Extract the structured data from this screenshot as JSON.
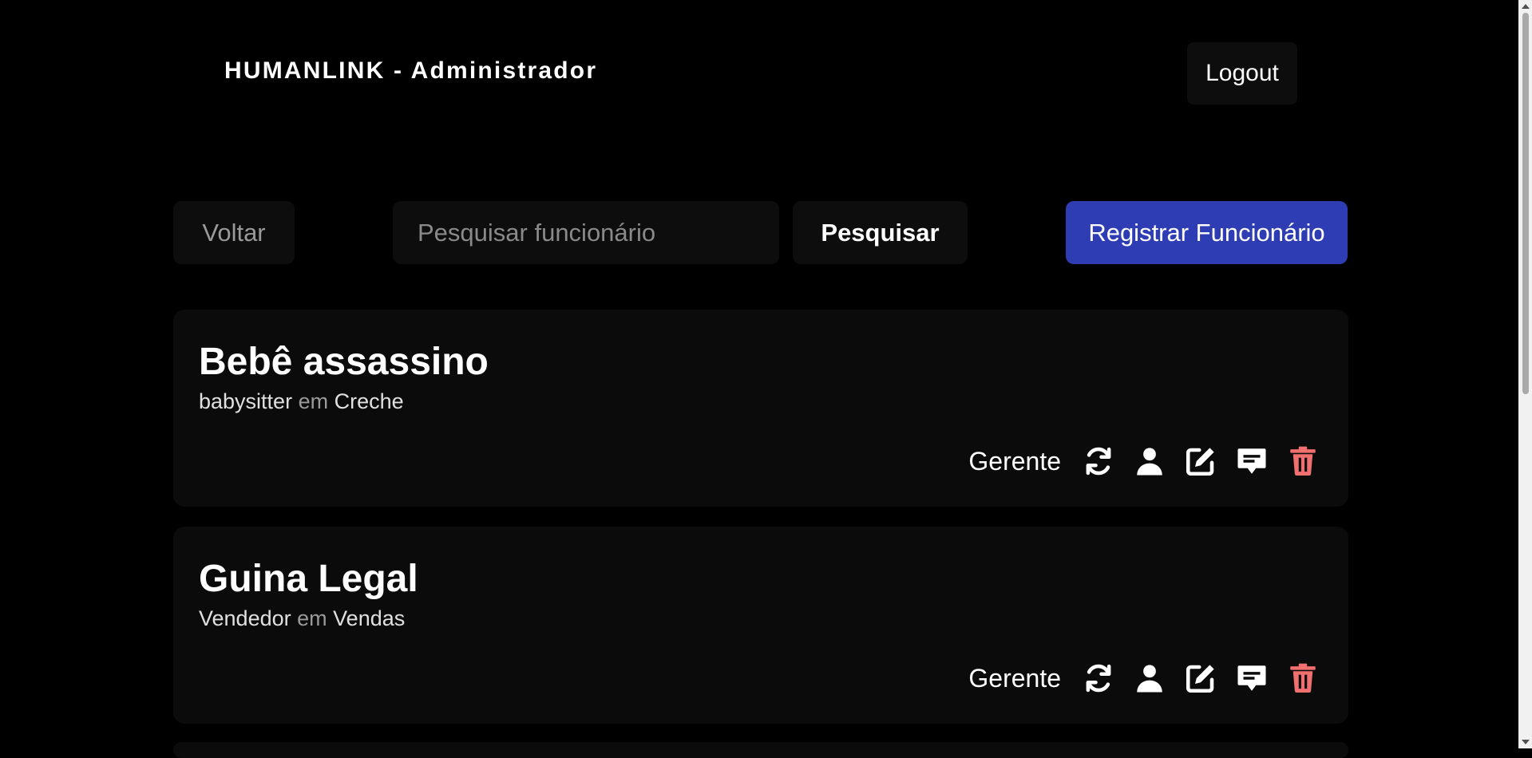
{
  "header": {
    "title": "HUMANLINK - Administrador",
    "logout_label": "Logout"
  },
  "toolbar": {
    "back_label": "Voltar",
    "search_placeholder": "Pesquisar funcionário",
    "search_button_label": "Pesquisar",
    "register_button_label": "Registrar Funcionário"
  },
  "employees": [
    {
      "name": "Bebê assassino",
      "role": "babysitter",
      "connector": "em",
      "department": "Creche",
      "level": "Gerente"
    },
    {
      "name": "Guina Legal",
      "role": "Vendedor",
      "connector": "em",
      "department": "Vendas",
      "level": "Gerente"
    }
  ],
  "icons": [
    "refresh-icon",
    "user-icon",
    "edit-icon",
    "message-icon",
    "trash-icon"
  ],
  "colors": {
    "background": "#000000",
    "card": "#0b0b0b",
    "button": "#0d0d0d",
    "accent": "#2f3db5",
    "danger": "#f07070"
  }
}
